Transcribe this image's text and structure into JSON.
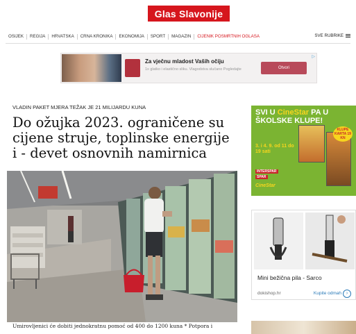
{
  "header": {
    "logo_text": "Glas Slavonije",
    "brand_color": "#d6161d"
  },
  "nav": {
    "items": [
      "OSIJEK",
      "REGIJA",
      "HRVATSKA",
      "CRNA KRONIKA",
      "EKONOMIJA",
      "SPORT",
      "MAGAZIN"
    ],
    "highlight_item": "CIJENIK POSMRTNIH OGLASA",
    "more_label": "SVE RUBRIKE"
  },
  "top_ad": {
    "title": "Za vječnu mladost Vaših očiju",
    "text": "1x glatko i elastično sliku. Vlagodstva slučano Pogledajte",
    "button_label": "Otvori"
  },
  "article": {
    "kicker": "VLADIN PAKET MJERA TEŽAK JE 21 MILIJARDU KUNA",
    "headline": "Do ožujka 2023. ograničene su cijene struje, toplinske energije i - devet osnovnih namirnica",
    "caption": "Umirovljenici će dobiti jednokratnu pomoć od 400 do 1200 kuna * Potpora i"
  },
  "cinestar_ad": {
    "headline_part1": "SVI U ",
    "headline_brand": "CineStar",
    "headline_part2": " PA U ŠKOLSKE KLUPE!",
    "dates": "3. i 4. 9. od 11 do 19 sati",
    "tag1": "INTERSPAR",
    "tag2": "SPAR",
    "badge": "KLUPE KARTA 19 KN",
    "logo": "CineStar",
    "accent_color": "#7bb432"
  },
  "saw_ad": {
    "title": "Mini bežična pila - Sarco",
    "shop": "dokishop.hr",
    "link_label": "Kupite odmah",
    "arrow_icon": "chevron-right-icon"
  }
}
